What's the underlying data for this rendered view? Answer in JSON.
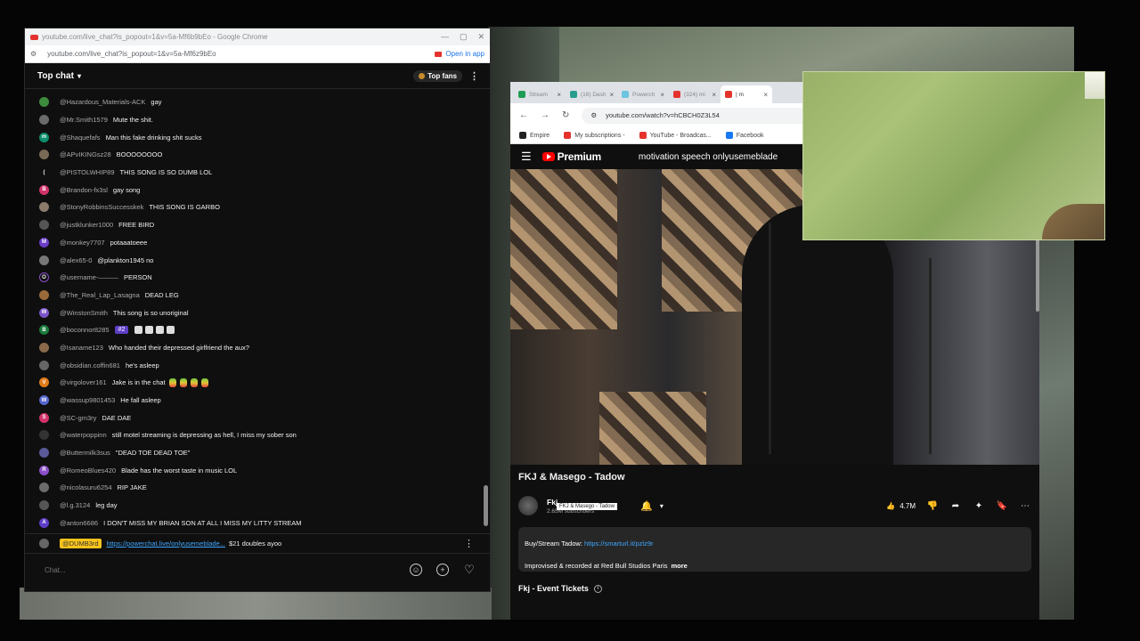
{
  "chat_window": {
    "title": "youtube.com/live_chat?is_popout=1&v=5a-Mf6b9bEo - Google Chrome",
    "url": "youtube.com/live_chat?is_popout=1&v=5a-Mf6z9bEo",
    "open_in_app": "Open in app",
    "header": "Top chat",
    "top_fans": "Top fans",
    "messages": [
      {
        "author": "@Hazardous_Materials-ACK",
        "text": "gay",
        "avatar_color": "#3d8b3d",
        "initial": ""
      },
      {
        "author": "@Mr.Smith1579",
        "text": "Mute the shit.",
        "avatar_color": "#6b6b6b",
        "initial": ""
      },
      {
        "author": "@Shaquefafs",
        "text": "Man this fake drinking shit sucks",
        "avatar_color": "#0b8f6b",
        "initial": "m"
      },
      {
        "author": "@APvIKINGsz28",
        "text": "BOOOOOOOO",
        "avatar_color": "#7a6a55",
        "initial": ""
      },
      {
        "author": "@PISTOLWHIP89",
        "text": "THIS SONG IS SO DUMB LOL",
        "avatar_color": "#0f0f0f",
        "initial": "("
      },
      {
        "author": "@Brandon-fx3sl",
        "text": "gay song",
        "avatar_color": "#d2326a",
        "initial": "B"
      },
      {
        "author": "@StonyRobbinsSuccesskek",
        "text": "THIS SONG IS GARBO",
        "avatar_color": "#8c7a6b",
        "initial": ""
      },
      {
        "author": "@justklunker1000",
        "text": "FREE BIRD",
        "avatar_color": "#555555",
        "initial": ""
      },
      {
        "author": "@monkey7707",
        "text": "potaaatoeee",
        "avatar_color": "#6a3cc7",
        "initial": "M"
      },
      {
        "author": "@alex65-0",
        "text": "@plankton1945 no",
        "avatar_color": "#777777",
        "initial": ""
      },
      {
        "author": "@username-———",
        "text": "PERSON",
        "avatar_color": "#0f0f0f",
        "initial": "O"
      },
      {
        "author": "@The_Real_Lap_Lasagna",
        "text": "DEAD LEG",
        "avatar_color": "#9a6a3a",
        "initial": ""
      },
      {
        "author": "@WinstonSmith",
        "text": "This song is so unoriginal",
        "avatar_color": "#7b55c9",
        "initial": "W"
      },
      {
        "author": "@boconnor8285",
        "text": "",
        "avatar_color": "#1b7a3a",
        "initial": "B",
        "badge": "#2"
      },
      {
        "author": "@Isaname123",
        "text": "Who handed their depressed girlfriend the aux?",
        "avatar_color": "#8a6a4a",
        "initial": ""
      },
      {
        "author": "@obsidian.coffin681",
        "text": "he's asleep",
        "avatar_color": "#666666",
        "initial": ""
      },
      {
        "author": "@virgolover161",
        "text": "Jake is in the chat",
        "avatar_color": "#e07b1a",
        "initial": "V",
        "parrots": 4
      },
      {
        "author": "@wassup9801453",
        "text": "He fall asleep",
        "avatar_color": "#5566cc",
        "initial": "W"
      },
      {
        "author": "@SC-gm3ry",
        "text": "DAE DAE",
        "avatar_color": "#d2326a",
        "initial": "S"
      },
      {
        "author": "@waterpoppinn",
        "text": "still motel streaming is depressing as hell, I miss my sober son",
        "avatar_color": "#333333",
        "initial": ""
      },
      {
        "author": "@Buttermilk3sus",
        "text": "\"DEAD TOE DEAD TOE\"",
        "avatar_color": "#5a5a9a",
        "initial": ""
      },
      {
        "author": "@RomeoBlues420",
        "text": "Blade has the worst taste in music LOL",
        "avatar_color": "#8a4fc9",
        "initial": "R"
      },
      {
        "author": "@nicolasuru6254",
        "text": "RIP JAKE",
        "avatar_color": "#6b6b6b",
        "initial": ""
      },
      {
        "author": "@l.g.3124",
        "text": "leg day",
        "avatar_color": "#555555",
        "initial": ""
      },
      {
        "author": "@anton6686",
        "text": "I DON'T MISS MY BRIAN SON AT ALL I MISS MY LITTY STREAM",
        "avatar_color": "#5e3ec6",
        "initial": "A"
      }
    ],
    "pinned": {
      "badge": "@DUMB3rd",
      "link": "https://powerchat.live/onlyusemeblade...",
      "text": "$21 doubles ayoo"
    },
    "input_placeholder": "Chat..."
  },
  "youtube_window": {
    "tabs": [
      {
        "label": "Stream",
        "color": "#1f9d55"
      },
      {
        "label": "(16) Dash",
        "color": "#2a9d8f"
      },
      {
        "label": "Powerch",
        "color": "#6ac5e0"
      },
      {
        "label": "(324) mi",
        "color": "#e5322d"
      },
      {
        "label": "| m",
        "color": "#e5322d"
      }
    ],
    "url": "youtube.com/watch?v=hCBCH0Z3L54",
    "bookmarks": [
      {
        "label": "Empire",
        "color": "#222222"
      },
      {
        "label": "My subscriptions -",
        "color": "#e5322d"
      },
      {
        "label": "YouTube - Broadcas...",
        "color": "#e5322d"
      },
      {
        "label": "Facebook",
        "color": "#1877f2"
      }
    ],
    "logo_text": "Premium",
    "search_query": "motivation speech onlyusemeblade",
    "video_title": "FKJ & Masego - Tadow",
    "tooltip": "FKJ & Masego - Tadow",
    "channel_name": "Fkj",
    "channel_subs": "2.65M subscribers",
    "likes": "4.7M",
    "description_line1_prefix": "Buy/Stream Tadow:",
    "description_link": "https://smarturl.it/pzlz9r",
    "description_line2": "Improvised & recorded at Red Bull Studios Paris",
    "more": "more",
    "event_tickets": "Fkj - Event Tickets"
  }
}
